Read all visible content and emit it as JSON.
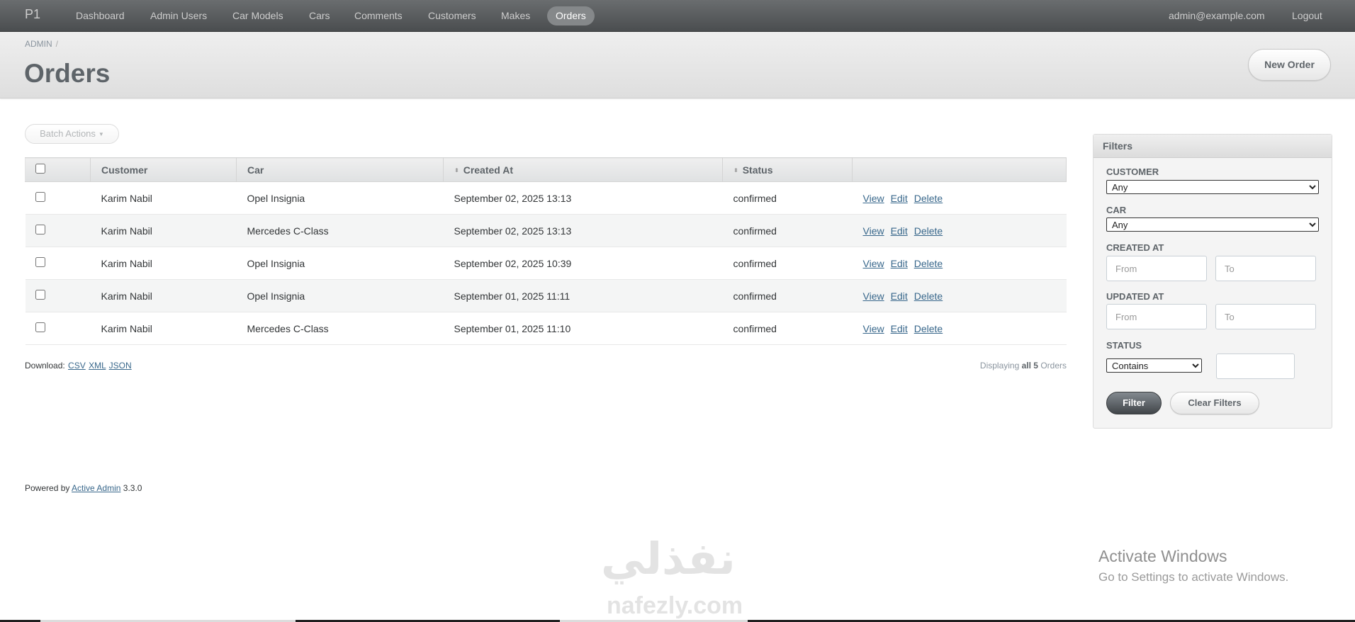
{
  "header": {
    "site_title": "P1",
    "nav": [
      {
        "label": "Dashboard",
        "current": false
      },
      {
        "label": "Admin Users",
        "current": false
      },
      {
        "label": "Car Models",
        "current": false
      },
      {
        "label": "Cars",
        "current": false
      },
      {
        "label": "Comments",
        "current": false
      },
      {
        "label": "Customers",
        "current": false
      },
      {
        "label": "Makes",
        "current": false
      },
      {
        "label": "Orders",
        "current": true
      }
    ],
    "user_email": "admin@example.com",
    "logout": "Logout"
  },
  "title_bar": {
    "breadcrumb": "ADMIN",
    "breadcrumb_sep": "/",
    "title": "Orders",
    "new_button": "New Order"
  },
  "batch_actions": "Batch Actions",
  "table": {
    "columns": [
      "",
      "Customer",
      "Car",
      "Created At",
      "Status",
      ""
    ],
    "sortable": [
      false,
      false,
      false,
      true,
      true,
      false
    ],
    "rows": [
      {
        "customer": "Karim Nabil",
        "car": "Opel Insignia",
        "created_at": "September 02, 2025 13:13",
        "status": "confirmed"
      },
      {
        "customer": "Karim Nabil",
        "car": "Mercedes C-Class",
        "created_at": "September 02, 2025 13:13",
        "status": "confirmed"
      },
      {
        "customer": "Karim Nabil",
        "car": "Opel Insignia",
        "created_at": "September 02, 2025 10:39",
        "status": "confirmed"
      },
      {
        "customer": "Karim Nabil",
        "car": "Opel Insignia",
        "created_at": "September 01, 2025 11:11",
        "status": "confirmed"
      },
      {
        "customer": "Karim Nabil",
        "car": "Mercedes C-Class",
        "created_at": "September 01, 2025 11:10",
        "status": "confirmed"
      }
    ],
    "actions": {
      "view": "View",
      "edit": "Edit",
      "delete": "Delete"
    }
  },
  "download": {
    "label": "Download:",
    "formats": [
      "CSV",
      "XML",
      "JSON"
    ]
  },
  "pagination": {
    "prefix": "Displaying",
    "count": "all 5",
    "suffix": "Orders"
  },
  "filters": {
    "title": "Filters",
    "customer": {
      "label": "CUSTOMER",
      "value": "Any"
    },
    "car": {
      "label": "CAR",
      "value": "Any"
    },
    "created_at": {
      "label": "CREATED AT",
      "from_placeholder": "From",
      "to_placeholder": "To"
    },
    "updated_at": {
      "label": "UPDATED AT",
      "from_placeholder": "From",
      "to_placeholder": "To"
    },
    "status": {
      "label": "STATUS",
      "operator": "Contains",
      "value": ""
    },
    "submit": "Filter",
    "clear": "Clear Filters"
  },
  "footer": {
    "prefix": "Powered by",
    "link": "Active Admin",
    "version": "3.3.0"
  },
  "overlay": {
    "watermark_arabic": "نفذلي",
    "watermark_latin": "nafezly.com",
    "activate_title": "Activate Windows",
    "activate_sub": "Go to Settings to activate Windows."
  },
  "colors": {
    "header_bg": "#4a4d4f",
    "link": "#38678b",
    "title": "#5e6469"
  }
}
